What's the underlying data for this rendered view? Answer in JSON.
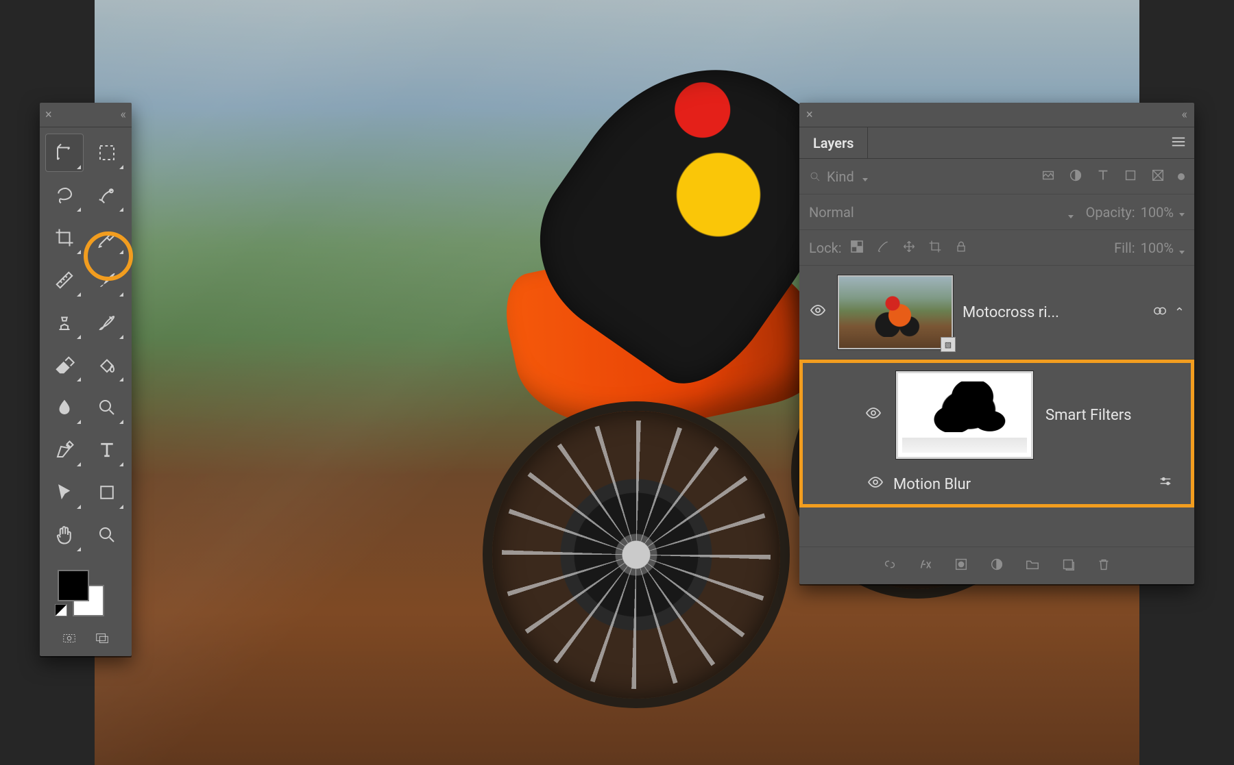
{
  "tools": {
    "items": [
      {
        "name": "move-tool"
      },
      {
        "name": "marquee-tool"
      },
      {
        "name": "lasso-tool"
      },
      {
        "name": "quick-select-tool"
      },
      {
        "name": "crop-tool"
      },
      {
        "name": "eyedropper-tool"
      },
      {
        "name": "ruler-tool"
      },
      {
        "name": "brush-tool"
      },
      {
        "name": "clone-stamp-tool"
      },
      {
        "name": "history-brush-tool"
      },
      {
        "name": "eraser-tool"
      },
      {
        "name": "paint-bucket-tool"
      },
      {
        "name": "blur-tool"
      },
      {
        "name": "dodge-tool"
      },
      {
        "name": "pen-tool"
      },
      {
        "name": "type-tool"
      },
      {
        "name": "path-select-tool"
      },
      {
        "name": "shape-tool"
      },
      {
        "name": "hand-tool"
      },
      {
        "name": "zoom-tool"
      }
    ],
    "highlighted": "brush-tool"
  },
  "layers": {
    "tab_label": "Layers",
    "filter": {
      "label": "Kind"
    },
    "blend": {
      "mode": "Normal",
      "opacity_label": "Opacity:",
      "opacity_value": "100%"
    },
    "lock": {
      "label": "Lock:",
      "fill_label": "Fill:",
      "fill_value": "100%"
    },
    "items": [
      {
        "name": "Motocross ri...",
        "visible": true,
        "smart_object": true
      }
    ],
    "smart_filters": {
      "heading": "Smart Filters",
      "entries": [
        {
          "name": "Motion Blur",
          "visible": true
        }
      ]
    }
  },
  "colors": {
    "highlight": "#f29d1f",
    "panel_bg": "#535353",
    "app_bg": "#262626"
  }
}
